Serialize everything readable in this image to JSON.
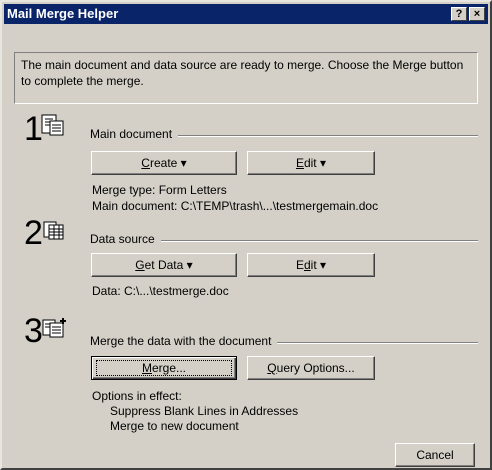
{
  "window": {
    "title": "Mail Merge Helper",
    "help_glyph": "?",
    "close_glyph": "×"
  },
  "intro": "The main document and data source are ready to merge. Choose the Merge button to complete the merge.",
  "steps": [
    {
      "number": "1",
      "label": "Main document",
      "buttons": [
        {
          "pre": "",
          "ul": "C",
          "post": "reate",
          "arrow": "▾"
        },
        {
          "pre": "",
          "ul": "E",
          "post": "dit",
          "arrow": "▾"
        }
      ],
      "info": [
        "Merge type: Form Letters",
        "Main document: C:\\TEMP\\trash\\...\\testmergemain.doc"
      ]
    },
    {
      "number": "2",
      "label": "Data source",
      "buttons": [
        {
          "pre": "",
          "ul": "G",
          "post": "et Data",
          "arrow": "▾"
        },
        {
          "pre": "E",
          "ul": "d",
          "post": "it",
          "arrow": "▾"
        }
      ],
      "info": [
        "Data: C:\\...\\testmerge.doc"
      ]
    },
    {
      "number": "3",
      "label": "Merge the data with the document",
      "buttons": [
        {
          "pre": "",
          "ul": "M",
          "post": "erge...",
          "arrow": ""
        },
        {
          "pre": "",
          "ul": "Q",
          "post": "uery Options...",
          "arrow": ""
        }
      ],
      "info": [
        "Options in effect:",
        "Suppress Blank Lines in Addresses",
        "Merge to new document"
      ]
    }
  ],
  "footer": {
    "cancel": "Cancel"
  },
  "colors": {
    "face": "#d4d0c8",
    "titlebar": "#0a246a"
  }
}
